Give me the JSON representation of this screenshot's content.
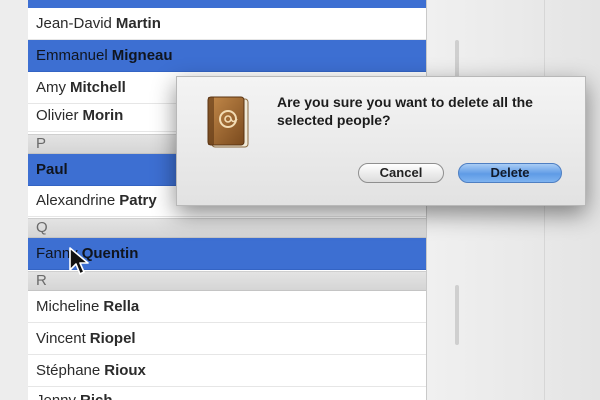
{
  "contacts": {
    "rows": [
      {
        "first": "Jean-David",
        "last": "Martin",
        "selected": false
      },
      {
        "first": "Emmanuel",
        "last": "Migneau",
        "selected": true
      },
      {
        "first": "Amy",
        "last": "Mitchell",
        "selected": false
      },
      {
        "first": "Olivier",
        "last": "Morin",
        "selected": false
      },
      {
        "first": "Paul",
        "last": "",
        "selected": true
      },
      {
        "first": "Alexandrine",
        "last": "Patry",
        "selected": false
      },
      {
        "first": "Fanny",
        "last": "Quentin",
        "selected": true
      },
      {
        "first": "Micheline",
        "last": "Rella",
        "selected": false
      },
      {
        "first": "Vincent",
        "last": "Riopel",
        "selected": false
      },
      {
        "first": "Stéphane",
        "last": "Rioux",
        "selected": false
      },
      {
        "first": "Jenny",
        "last": "Rich",
        "selected": false
      }
    ],
    "headers": [
      "P",
      "Q",
      "R"
    ]
  },
  "dialog": {
    "message": "Are you sure you want to delete all the selected people?",
    "cancel_label": "Cancel",
    "delete_label": "Delete",
    "icon": "address-book-icon"
  },
  "colors": {
    "selection": "#3d6fd2",
    "default_button": "#5f9be6"
  }
}
